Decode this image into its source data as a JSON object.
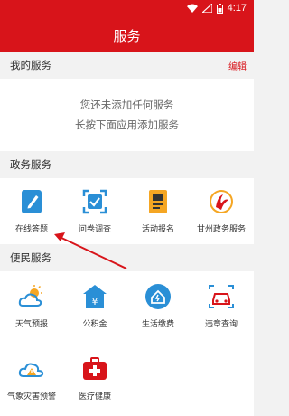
{
  "status_bar": {
    "time": "4:17"
  },
  "header": {
    "title": "服务"
  },
  "my_services": {
    "title": "我的服务",
    "edit_label": "编辑",
    "empty_line1": "您还未添加任何服务",
    "empty_line2": "长按下面应用添加服务"
  },
  "gov_services": {
    "title": "政务服务",
    "items": [
      {
        "label": "在线答题",
        "icon": "edit-icon"
      },
      {
        "label": "问卷调查",
        "icon": "survey-icon"
      },
      {
        "label": "活动报名",
        "icon": "signup-icon"
      },
      {
        "label": "甘州政务服务",
        "icon": "ganzhou-logo-icon"
      }
    ]
  },
  "public_services": {
    "title": "便民服务",
    "items": [
      {
        "label": "天气预报",
        "icon": "weather-icon"
      },
      {
        "label": "公积金",
        "icon": "provident-fund-icon"
      },
      {
        "label": "生活缴费",
        "icon": "bill-payment-icon"
      },
      {
        "label": "违章查询",
        "icon": "traffic-violation-icon"
      },
      {
        "label": "气象灾害预警",
        "icon": "weather-warning-icon"
      },
      {
        "label": "医疗健康",
        "icon": "medical-icon"
      }
    ]
  },
  "colors": {
    "brand_red": "#d8141a",
    "icon_blue": "#2a8fd6",
    "icon_orange": "#f5a623"
  }
}
